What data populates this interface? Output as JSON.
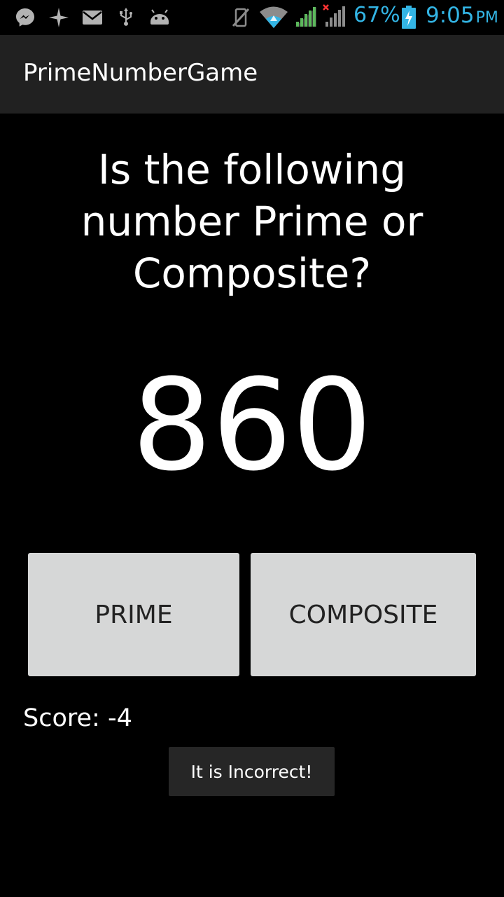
{
  "status_bar": {
    "notification_icons": [
      "messenger-icon",
      "sparkle-icon",
      "mail-icon",
      "usb-icon",
      "android-debug-icon"
    ],
    "system_icons": [
      "mute-icon",
      "wifi-icon",
      "signal-icon",
      "signal-no-data-icon",
      "battery-charging-icon"
    ],
    "battery_text": "67%",
    "clock_time": "9:05",
    "clock_ampm": "PM",
    "accent_color": "#33b5e5"
  },
  "action_bar": {
    "title": "PrimeNumberGame"
  },
  "game": {
    "question": "Is the following number Prime or Composite?",
    "number": "860",
    "prime_label": "PRIME",
    "composite_label": "COMPOSITE",
    "score": "Score: -4"
  },
  "toast": {
    "message": "It is Incorrect!"
  },
  "colors": {
    "background": "#000000",
    "action_bar": "#212121",
    "button": "#d6d7d7",
    "toast": "#262626"
  }
}
